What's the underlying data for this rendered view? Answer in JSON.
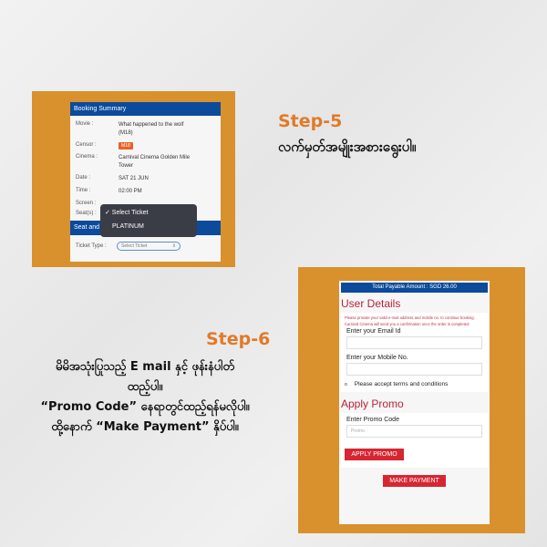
{
  "step5": {
    "title": "Step-5",
    "text": "လက်မှတ်အမျိုးအစားရွေးပါ။"
  },
  "step6": {
    "title": "Step-6",
    "lines": [
      "မိမိအသုံးပြုသည့် E mail နှင့် ဖုန်းနံပါတ်",
      "ထည့်ပါ။",
      "“Promo Code” နေရာတွင်ထည့်ရန်မလိုပါ။",
      "ထို့နောက် “Make Payment” နှိပ်ပါ။"
    ]
  },
  "booking": {
    "title": "Booking Summary",
    "movie_label": "Movie :",
    "movie": "What happened to the wolf (M18)",
    "censor_label": "Censor :",
    "censor": "M18",
    "cinema_label": "Cinema :",
    "cinema": "Carnival Cinema Golden Mile Tower",
    "date_label": "Date :",
    "date": "SAT 21 JUN",
    "time_label": "Time :",
    "time": "02:00 PM",
    "screen_label": "Screen :",
    "seats_label": "Seat(s) :",
    "section": "Seat and",
    "ticket_type_label": "Ticket Type :",
    "ticket_select": "Select Ticket",
    "dropdown": [
      "✓ Select Ticket",
      "PLATINUM"
    ]
  },
  "payment": {
    "total": "Total Payable Amount : SGD 26.00",
    "user_details": "User Details",
    "notice": "Please provide your valid e-mail address and mobile no. to continue booking. Carnival Cinema will send you a confirmation once the order is completed",
    "email_label": "Enter your Email Id",
    "mobile_label": "Enter your Mobile No.",
    "terms": "Please accept terms and conditions",
    "apply_promo": "Apply Promo",
    "promo_label": "Enter Promo Code",
    "promo_placeholder": "Promo",
    "apply_button": "APPLY PROMO",
    "pay_button": "MAKE PAYMENT"
  }
}
